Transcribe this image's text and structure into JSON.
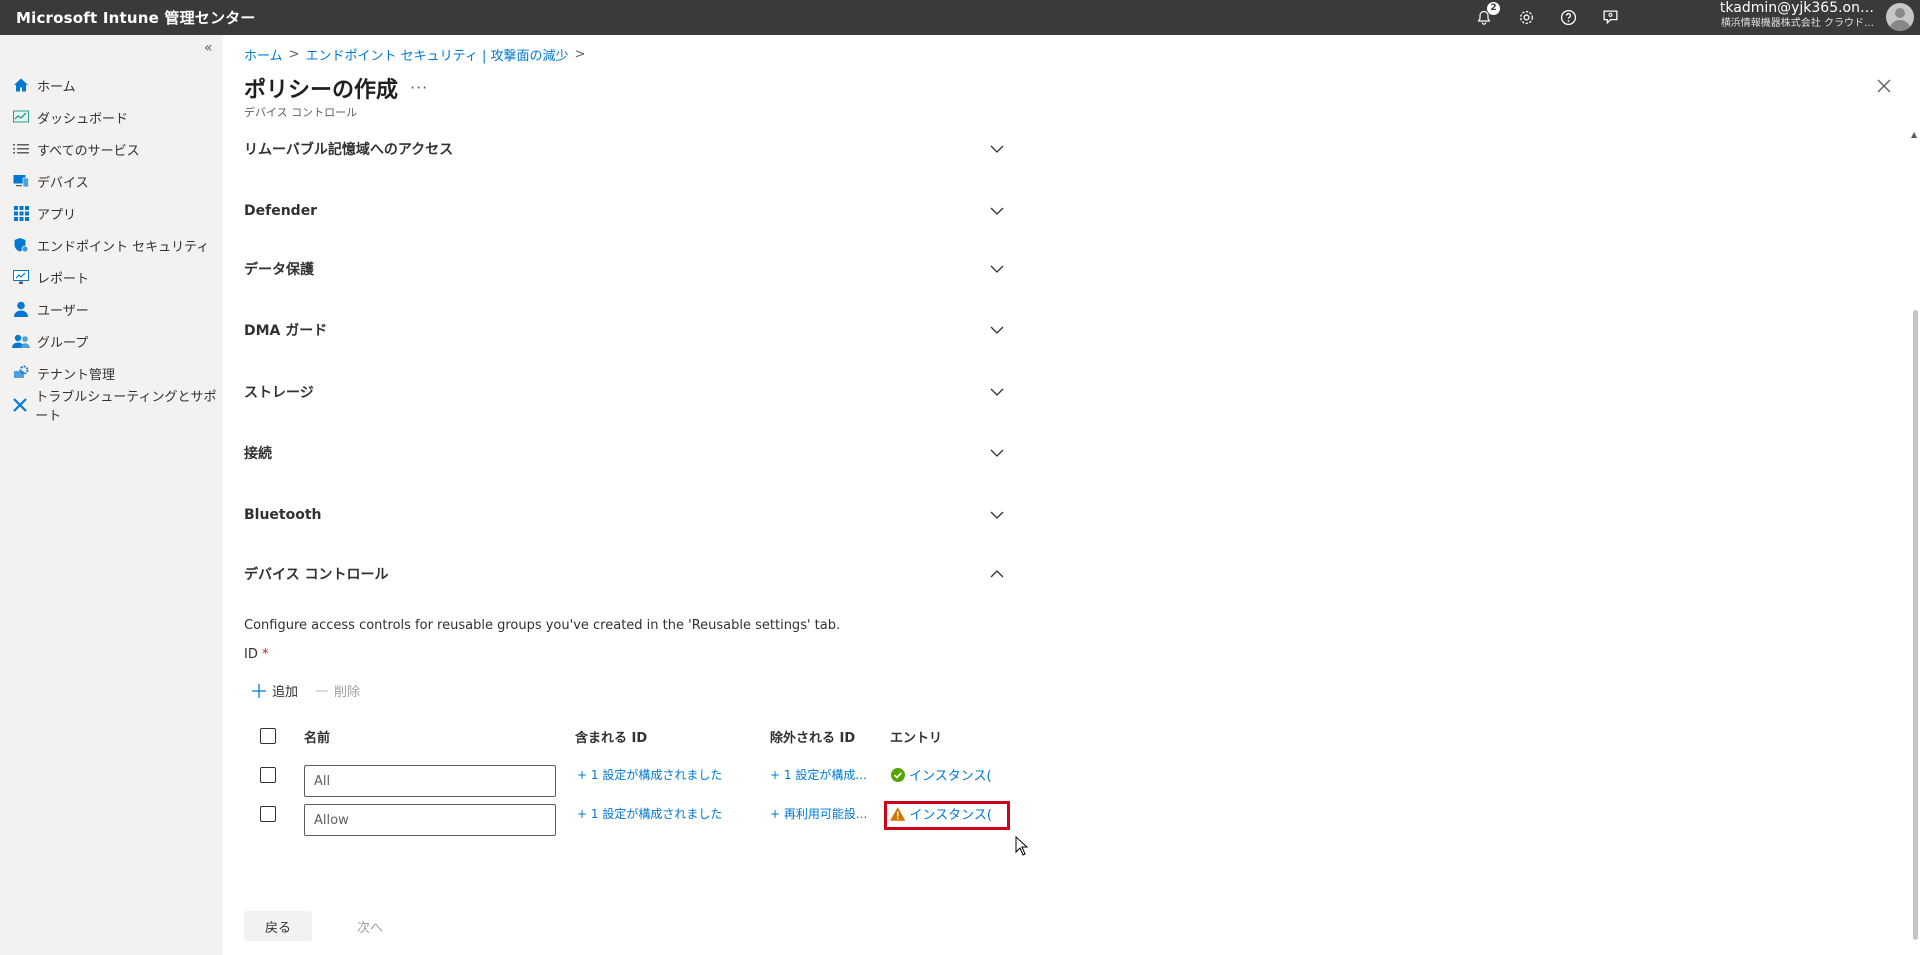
{
  "app": {
    "title": "Microsoft Intune 管理センター"
  },
  "topbar": {
    "notification_count": "2",
    "account_name": "tkadmin@yjk365.on…",
    "account_org": "横浜情報機器株式会社  クラウド…"
  },
  "sidebar": {
    "collapse_glyph": "«",
    "items": [
      {
        "label": "ホーム",
        "icon": "home-icon"
      },
      {
        "label": "ダッシュボード",
        "icon": "dashboard-icon"
      },
      {
        "label": "すべてのサービス",
        "icon": "list-icon"
      },
      {
        "label": "デバイス",
        "icon": "device-icon"
      },
      {
        "label": "アプリ",
        "icon": "apps-grid-icon"
      },
      {
        "label": "エンドポイント セキュリティ",
        "icon": "shield-icon"
      },
      {
        "label": "レポート",
        "icon": "report-icon"
      },
      {
        "label": "ユーザー",
        "icon": "user-icon"
      },
      {
        "label": "グループ",
        "icon": "group-icon"
      },
      {
        "label": "テナント管理",
        "icon": "tenant-icon"
      },
      {
        "label": "トラブルシューティングとサポート",
        "icon": "troubleshoot-icon"
      }
    ]
  },
  "breadcrumb": {
    "items": [
      "ホーム",
      "エンドポイント セキュリティ | 攻撃面の減少"
    ],
    "separator": ">"
  },
  "page": {
    "title": "ポリシーの作成",
    "more": "···",
    "subtitle": "デバイス コントロール"
  },
  "sections": [
    {
      "label": "リムーバブル記憶域へのアクセス",
      "expanded": false
    },
    {
      "label": "Defender",
      "expanded": false
    },
    {
      "label": "データ保護",
      "expanded": false
    },
    {
      "label": "DMA ガード",
      "expanded": false
    },
    {
      "label": "ストレージ",
      "expanded": false
    },
    {
      "label": "接続",
      "expanded": false
    },
    {
      "label": "Bluetooth",
      "expanded": false
    },
    {
      "label": "デバイス コントロール",
      "expanded": true
    }
  ],
  "device_control": {
    "description": "Configure access controls for reusable groups you've created in the 'Reusable settings' tab.",
    "id_label": "ID",
    "required_mark": "*",
    "toolbar": {
      "add": "追加",
      "delete": "削除"
    },
    "columns": [
      "名前",
      "含まれる ID",
      "除外される ID",
      "エントリ"
    ],
    "rows": [
      {
        "name": "All",
        "included": "+ 1 設定が構成されました",
        "excluded": "+ 1 設定が構成...",
        "entry": "インスタンス(",
        "status": "ok"
      },
      {
        "name": "Allow",
        "included": "+ 1 設定が構成されました",
        "excluded": "+ 再利用可能設...",
        "entry": "インスタンス(",
        "status": "warning"
      }
    ]
  },
  "footer": {
    "back": "戻る",
    "next": "次へ"
  },
  "colors": {
    "accent": "#0078d4",
    "topbar": "#3b3a39",
    "highlight": "#d0021b",
    "success": "#57a300",
    "warning": "#d47500"
  }
}
